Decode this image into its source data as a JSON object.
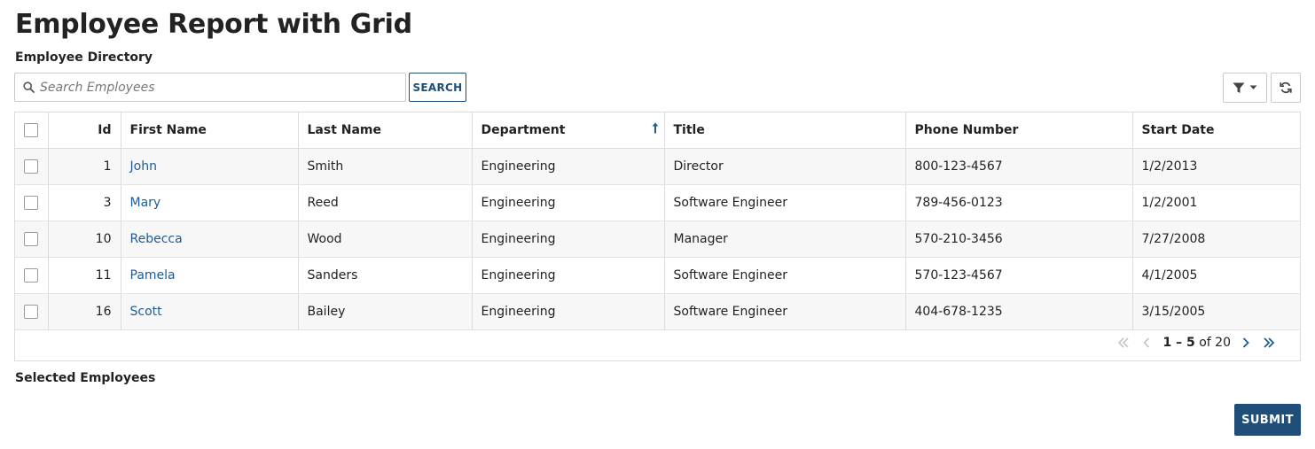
{
  "page": {
    "title": "Employee Report with Grid"
  },
  "directory": {
    "label": "Employee Directory"
  },
  "search": {
    "placeholder": "Search Employees",
    "value": "",
    "button_label": "SEARCH"
  },
  "toolbar": {
    "filter_icon": "filter-icon",
    "refresh_icon": "refresh-icon"
  },
  "grid": {
    "columns": [
      "Id",
      "First Name",
      "Last Name",
      "Department",
      "Title",
      "Phone Number",
      "Start Date"
    ],
    "sorted_column": "Department",
    "sort_direction": "ascending",
    "rows": [
      [
        "1",
        "John",
        "Smith",
        "Engineering",
        "Director",
        "800-123-4567",
        "1/2/2013"
      ],
      [
        "3",
        "Mary",
        "Reed",
        "Engineering",
        "Software Engineer",
        "789-456-0123",
        "1/2/2001"
      ],
      [
        "10",
        "Rebecca",
        "Wood",
        "Engineering",
        "Manager",
        "570-210-3456",
        "7/27/2008"
      ],
      [
        "11",
        "Pamela",
        "Sanders",
        "Engineering",
        "Software Engineer",
        "570-123-4567",
        "4/1/2005"
      ],
      [
        "16",
        "Scott",
        "Bailey",
        "Engineering",
        "Software Engineer",
        "404-678-1235",
        "3/15/2005"
      ]
    ]
  },
  "pagination": {
    "range": "1 – 5",
    "of_label": "of 20"
  },
  "selected": {
    "label": "Selected Employees"
  },
  "actions": {
    "submit_label": "SUBMIT"
  },
  "colors": {
    "primary": "#1f4e79",
    "link": "#1f5a94",
    "row_alt": "#f7f7f7",
    "border": "#dcdcdc"
  }
}
